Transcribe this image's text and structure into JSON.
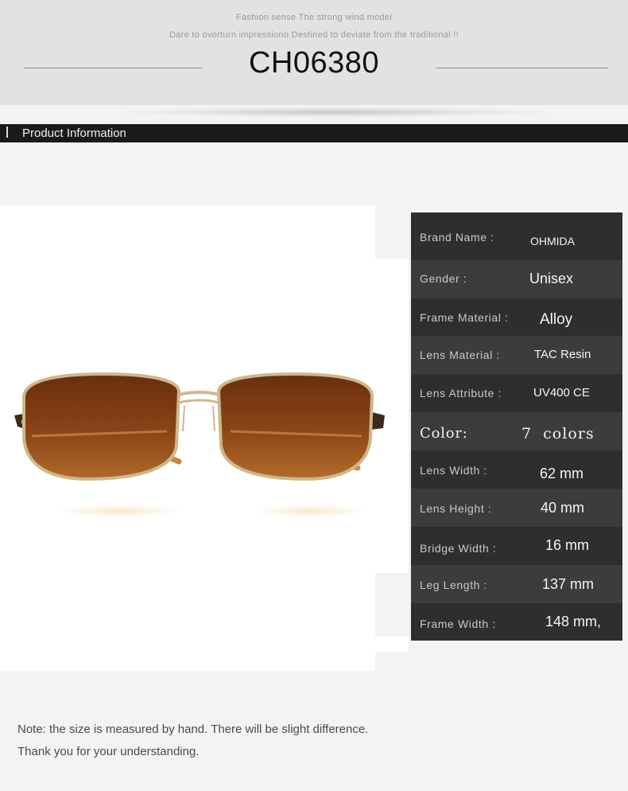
{
  "header": {
    "tagline_1": "Fashion sense The strong wind model",
    "tagline_2": "Dare to overturn impressiono Destined to deviate from the traditional !!",
    "model": "CH06380"
  },
  "section": {
    "title": "Product Information"
  },
  "product_image": {
    "description": "sunglasses-brown-lens-gold-frame"
  },
  "specs": [
    {
      "label": "Brand Name :",
      "value": "OHMIDA"
    },
    {
      "label": "Gender :",
      "value": "Unisex"
    },
    {
      "label": "Frame Material :",
      "value": "Alloy"
    },
    {
      "label": "Lens Material :",
      "value": "TAC Resin"
    },
    {
      "label": "Lens Attribute :",
      "value": "UV400 CE"
    },
    {
      "label": "Color:",
      "value": "7  colors"
    },
    {
      "label": "Lens Width :",
      "value": "62 mm"
    },
    {
      "label": "Lens Height :",
      "value": "40 mm"
    },
    {
      "label": "Bridge Width :",
      "value": "16 mm"
    },
    {
      "label": "Leg Length :",
      "value": "137 mm"
    },
    {
      "label": "Frame Width :",
      "value": "148 mm,"
    }
  ],
  "note": {
    "line_1": "Note: the size is measured by hand. There will be slight difference.",
    "line_2": "Thank you for your understanding."
  },
  "colors": {
    "spec_dark": "#2e2e2f",
    "spec_light": "#3c3c3d",
    "lens": "#7a3a12",
    "frame": "#c9b58a"
  }
}
